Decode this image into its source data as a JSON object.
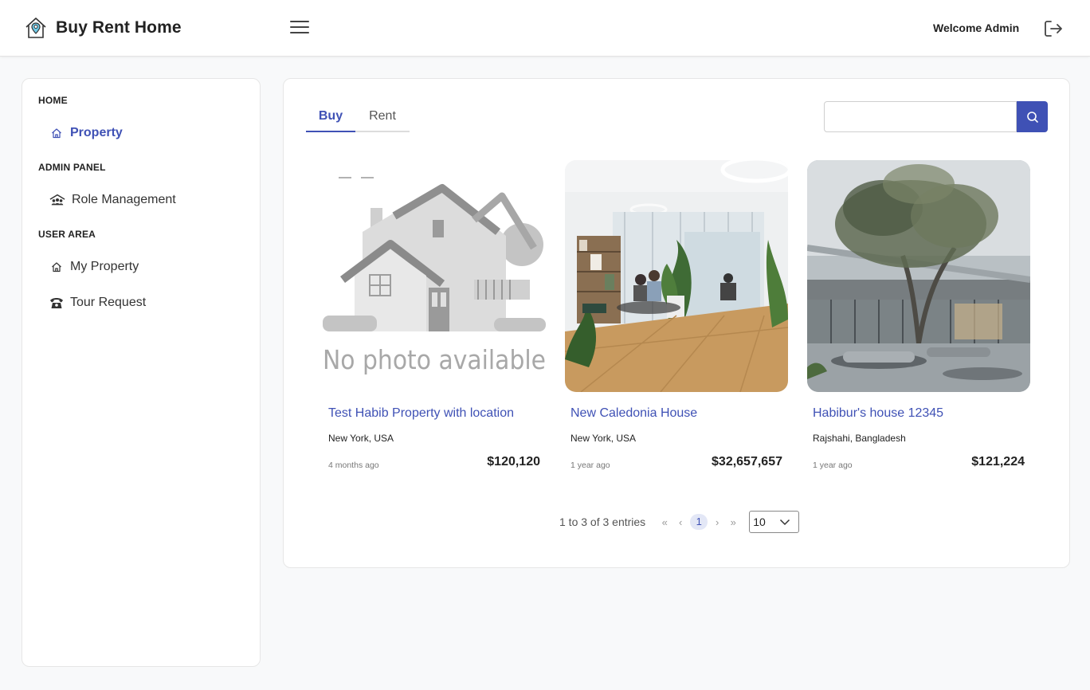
{
  "header": {
    "brand": "Buy Rent Home",
    "welcome": "Welcome Admin",
    "icons": {
      "logo": "house-pin-icon",
      "menu": "hamburger-icon",
      "logout": "logout-icon"
    }
  },
  "sidebar": {
    "sections": [
      {
        "title": "HOME",
        "items": [
          {
            "label": "Property",
            "icon": "home-icon",
            "active": true
          }
        ]
      },
      {
        "title": "ADMIN PANEL",
        "items": [
          {
            "label": "Role Management",
            "icon": "users-roof-icon",
            "active": false
          }
        ]
      },
      {
        "title": "USER AREA",
        "items": [
          {
            "label": "My Property",
            "icon": "home-icon",
            "active": false
          },
          {
            "label": "Tour Request",
            "icon": "phone-icon",
            "active": false
          }
        ]
      }
    ]
  },
  "main": {
    "tabs": [
      {
        "label": "Buy",
        "active": true
      },
      {
        "label": "Rent",
        "active": false
      }
    ],
    "search": {
      "placeholder": "",
      "value": ""
    },
    "no_photo_text": "No photo available",
    "cards": [
      {
        "title": "Test Habib Property with location",
        "location": "New York, USA",
        "time": "4 months ago",
        "price": "$120,120",
        "image": "no-photo"
      },
      {
        "title": "New Caledonia House",
        "location": "New York, USA",
        "time": "1 year ago",
        "price": "$32,657,657",
        "image": "interior-photo"
      },
      {
        "title": "Habibur's house 12345",
        "location": "Rajshahi, Bangladesh",
        "time": "1 year ago",
        "price": "$121,224",
        "image": "courtyard-photo"
      }
    ],
    "pagination": {
      "info": "1 to 3 of 3 entries",
      "first": "«",
      "prev": "‹",
      "current": "1",
      "next": "›",
      "last": "»",
      "page_size": "10"
    }
  },
  "colors": {
    "accent": "#3f51b5",
    "background": "#f8f9fa"
  }
}
